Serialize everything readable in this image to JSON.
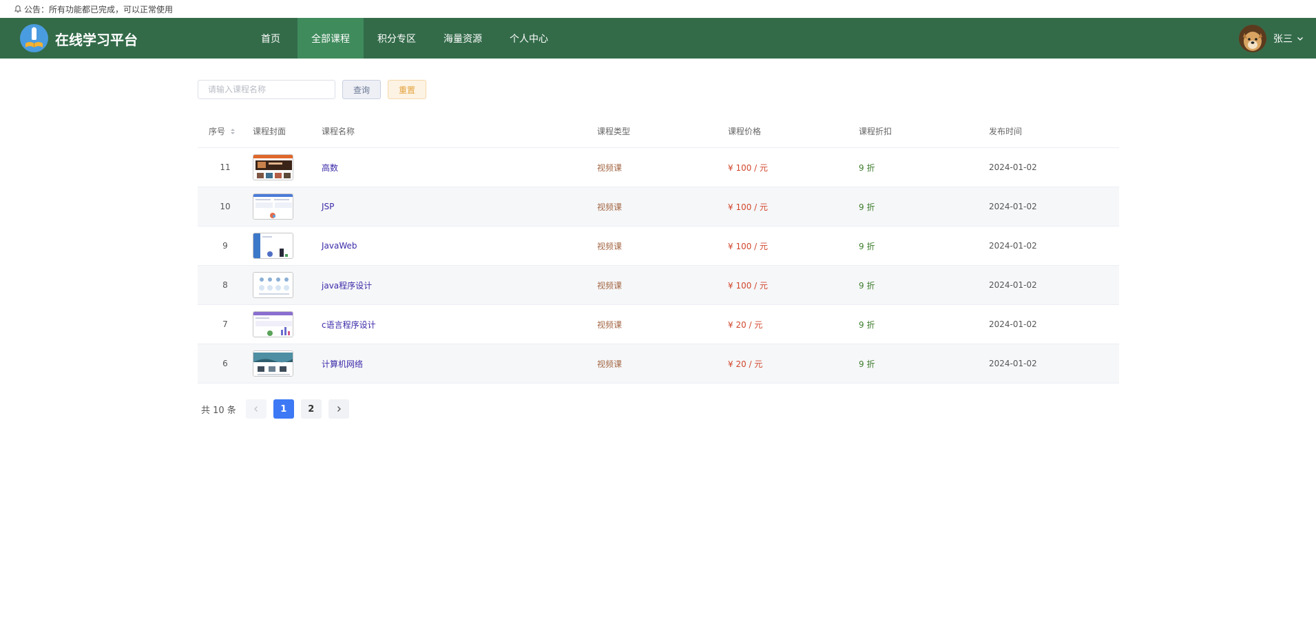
{
  "notice": {
    "text": "公告：所有功能都已完成，可以正常使用"
  },
  "header": {
    "brand": "在线学习平台",
    "nav": [
      {
        "label": "首页",
        "active": false
      },
      {
        "label": "全部课程",
        "active": true
      },
      {
        "label": "积分专区",
        "active": false
      },
      {
        "label": "海量资源",
        "active": false
      },
      {
        "label": "个人中心",
        "active": false
      }
    ],
    "user_name": "张三",
    "colors": {
      "bar": "#336b49",
      "active": "#3f8b5c"
    }
  },
  "search": {
    "placeholder": "请输入课程名称",
    "query_label": "查询",
    "reset_label": "重置"
  },
  "table": {
    "columns": [
      "序号",
      "课程封面",
      "课程名称",
      "课程类型",
      "课程价格",
      "课程折扣",
      "发布时间"
    ],
    "rows": [
      {
        "idx": "11",
        "name": "高数",
        "type": "视频课",
        "price": "¥ 100 / 元",
        "discount": "9 折",
        "date": "2024-01-02"
      },
      {
        "idx": "10",
        "name": "JSP",
        "type": "视频课",
        "price": "¥ 100 / 元",
        "discount": "9 折",
        "date": "2024-01-02"
      },
      {
        "idx": "9",
        "name": "JavaWeb",
        "type": "视频课",
        "price": "¥ 100 / 元",
        "discount": "9 折",
        "date": "2024-01-02"
      },
      {
        "idx": "8",
        "name": "java程序设计",
        "type": "视频课",
        "price": "¥ 100 / 元",
        "discount": "9 折",
        "date": "2024-01-02"
      },
      {
        "idx": "7",
        "name": "c语言程序设计",
        "type": "视频课",
        "price": "¥ 20 / 元",
        "discount": "9 折",
        "date": "2024-01-02"
      },
      {
        "idx": "6",
        "name": "计算机网络",
        "type": "视频课",
        "price": "¥ 20 / 元",
        "discount": "9 折",
        "date": "2024-01-02"
      }
    ]
  },
  "pagination": {
    "total_label": "共 10 条",
    "pages": [
      "1",
      "2"
    ],
    "current": "1"
  }
}
